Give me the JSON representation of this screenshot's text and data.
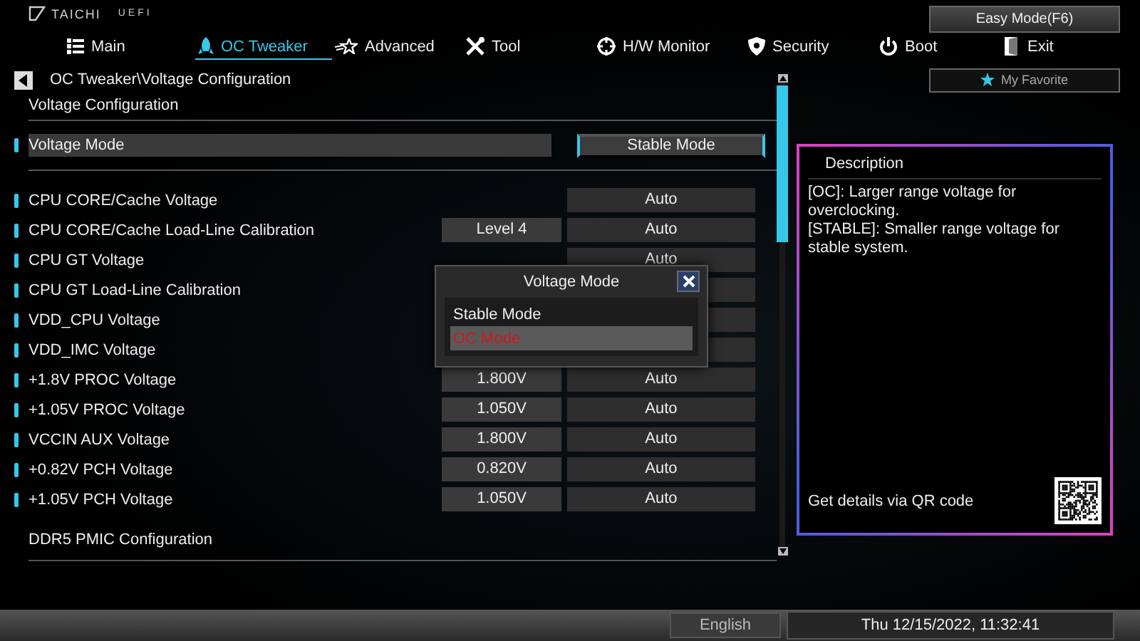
{
  "logo": {
    "brand": "TAICHI",
    "suffix": "UEFI"
  },
  "easy_mode_button": "Easy Mode(F6)",
  "tabs": [
    {
      "label": "Main",
      "selected": false
    },
    {
      "label": "OC Tweaker",
      "selected": true
    },
    {
      "label": "Advanced",
      "selected": false
    },
    {
      "label": "Tool",
      "selected": false
    },
    {
      "label": "H/W Monitor",
      "selected": false
    },
    {
      "label": "Security",
      "selected": false
    },
    {
      "label": "Boot",
      "selected": false
    },
    {
      "label": "Exit",
      "selected": false
    }
  ],
  "breadcrumb": "OC Tweaker\\Voltage Configuration",
  "favorite_button": "My Favorite",
  "section_title": "Voltage Configuration",
  "voltage_mode": {
    "label": "Voltage Mode",
    "value": "Stable Mode",
    "selected": true
  },
  "settings": [
    {
      "kind": "setting",
      "label": "CPU CORE/Cache Voltage",
      "mode": "Auto"
    },
    {
      "kind": "setting",
      "label": "CPU CORE/Cache Load-Line Calibration",
      "value": "Level 4",
      "mode": "Auto"
    },
    {
      "kind": "setting",
      "label": "CPU GT Voltage",
      "mode": "Auto"
    },
    {
      "kind": "setting",
      "label": "CPU GT Load-Line Calibration"
    },
    {
      "kind": "setting",
      "label": "VDD_CPU Voltage"
    },
    {
      "kind": "setting",
      "label": "VDD_IMC Voltage"
    },
    {
      "kind": "setting",
      "label": "+1.8V PROC Voltage",
      "value": "1.800V",
      "mode": "Auto"
    },
    {
      "kind": "setting",
      "label": "+1.05V PROC Voltage",
      "value": "1.050V",
      "mode": "Auto"
    },
    {
      "kind": "setting",
      "label": "VCCIN AUX Voltage",
      "value": "1.800V",
      "mode": "Auto"
    },
    {
      "kind": "setting",
      "label": "+0.82V PCH Voltage",
      "value": "0.820V",
      "mode": "Auto"
    },
    {
      "kind": "setting",
      "label": "+1.05V PCH Voltage",
      "value": "1.050V",
      "mode": "Auto"
    },
    {
      "kind": "submenu",
      "label": "DDR5 PMIC Configuration"
    }
  ],
  "dialog": {
    "title": "Voltage Mode",
    "options": [
      {
        "label": "Stable Mode",
        "selected": false
      },
      {
        "label": "OC Mode",
        "selected": true
      }
    ]
  },
  "description": {
    "title": "Description",
    "paragraphs": [
      "[OC]: Larger range voltage for overclocking.",
      "[STABLE]: Smaller range voltage for stable system."
    ],
    "qr_hint": "Get details via QR code"
  },
  "status_bar": {
    "language": "English",
    "datetime": "Thu 12/15/2022, 11:32:41"
  }
}
